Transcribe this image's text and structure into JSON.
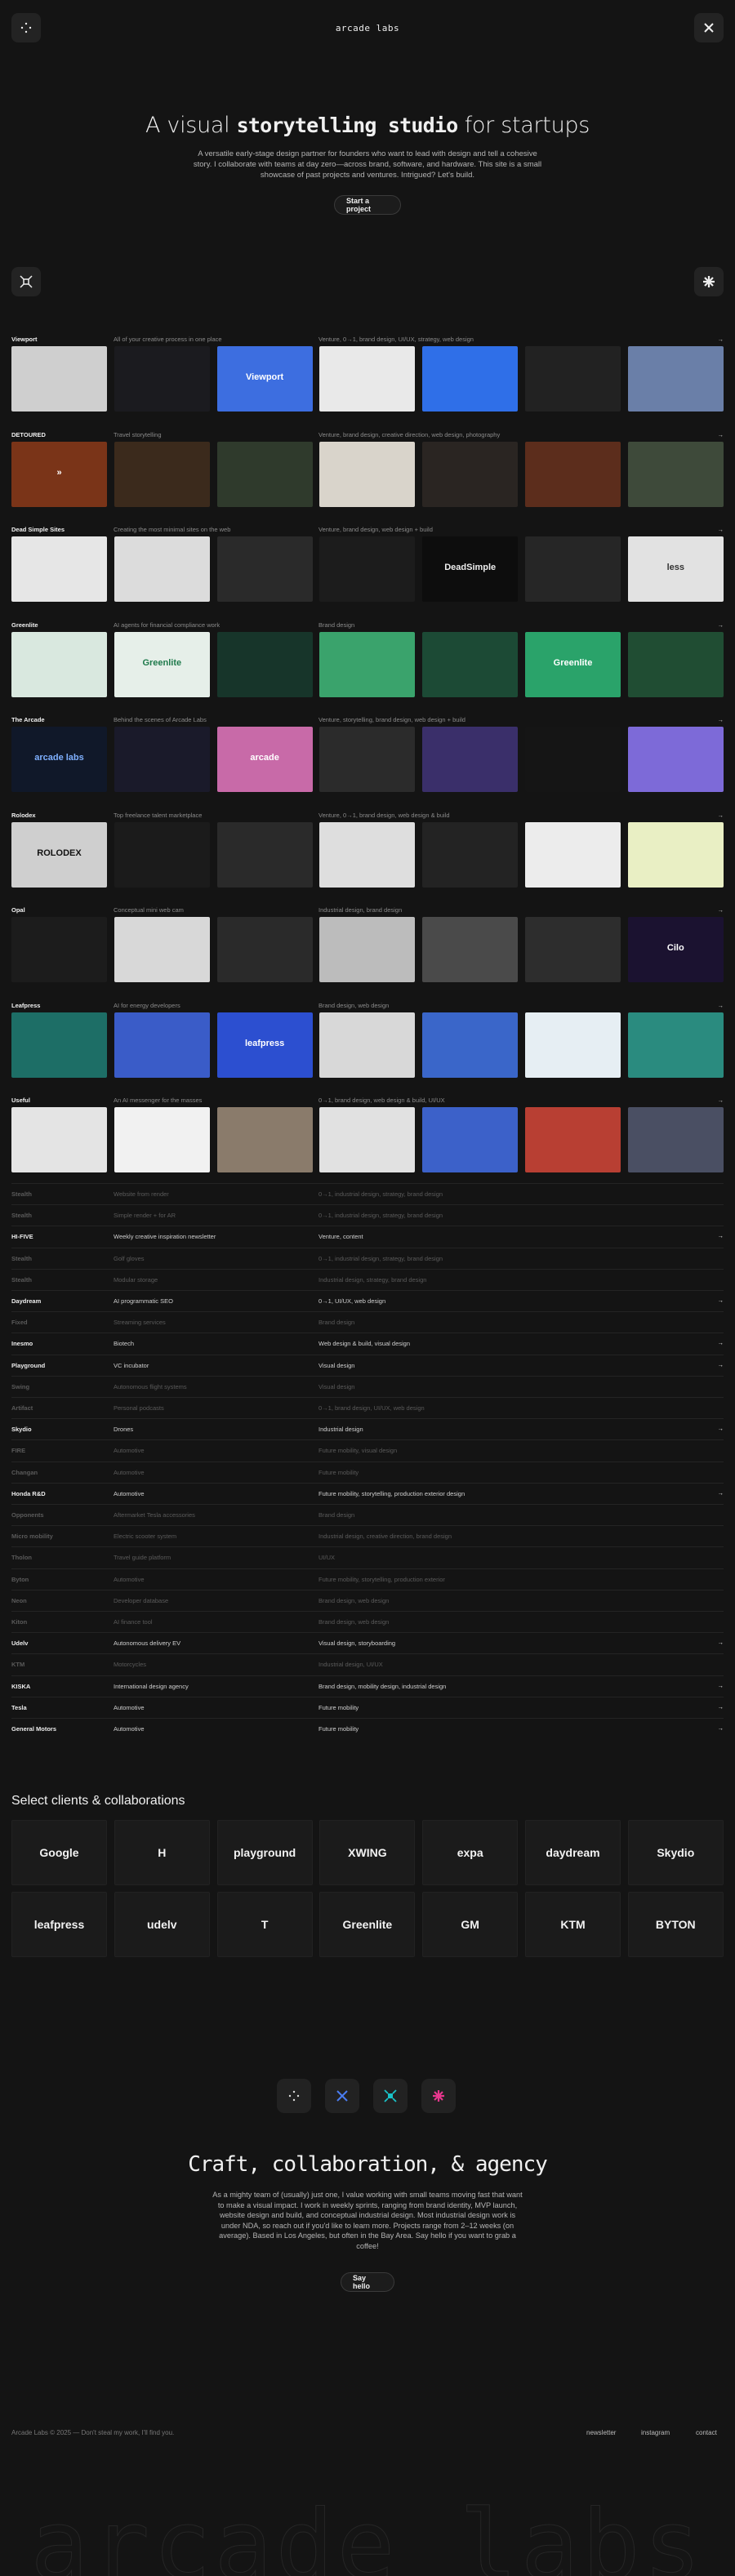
{
  "header": {
    "logo": "arcade labs"
  },
  "hero": {
    "title_pre": "A visual ",
    "title_bold": "storytelling studio",
    "title_post": " for startups",
    "subtitle": "A versatile early-stage design partner for founders who want to lead with design and tell a cohesive story. I collaborate with teams at day zero—across brand, software, and hardware. This site is a small showcase of past projects and ventures. Intrigued? Let's build.",
    "cta": "Start a project"
  },
  "projects": [
    {
      "name": "Viewport",
      "desc": "All of your creative process in one place",
      "tags": "Venture, 0→1, brand design, UI/UX, strategy, web design",
      "arrow": "→",
      "thumbs": [
        {
          "bg": "#cfcfcf",
          "fg": "#777",
          "label": ""
        },
        {
          "bg": "#1b1b1f",
          "fg": "#ddd",
          "label": ""
        },
        {
          "bg": "#3d6ee0",
          "fg": "#fff",
          "label": "Viewport"
        },
        {
          "bg": "#e9e9e9",
          "fg": "#888",
          "label": ""
        },
        {
          "bg": "#2f6fe8",
          "fg": "#fff",
          "label": ""
        },
        {
          "bg": "#222",
          "fg": "#eee",
          "label": ""
        },
        {
          "bg": "#6a7fa8",
          "fg": "#fff",
          "label": ""
        }
      ]
    },
    {
      "name": "DETOURED",
      "desc": "Travel storytelling",
      "tags": "Venture, brand design, creative direction, web design, photography",
      "arrow": "→",
      "thumbs": [
        {
          "bg": "#7a3418",
          "fg": "#fff",
          "label": "»"
        },
        {
          "bg": "#3b2a1c",
          "fg": "#eee",
          "label": ""
        },
        {
          "bg": "#2f3a2c",
          "fg": "#eee",
          "label": ""
        },
        {
          "bg": "#d9d4cb",
          "fg": "#333",
          "label": ""
        },
        {
          "bg": "#2a2522",
          "fg": "#eee",
          "label": ""
        },
        {
          "bg": "#5c2d1c",
          "fg": "#eee",
          "label": ""
        },
        {
          "bg": "#3e4a3a",
          "fg": "#eee",
          "label": ""
        }
      ]
    },
    {
      "name": "Dead Simple Sites",
      "desc": "Creating the most minimal sites on the web",
      "tags": "Venture, brand design, web design + build",
      "arrow": "→",
      "thumbs": [
        {
          "bg": "#e6e6e6",
          "fg": "#222",
          "label": ""
        },
        {
          "bg": "#dcdcdc",
          "fg": "#222",
          "label": ""
        },
        {
          "bg": "#2a2a2a",
          "fg": "#eee",
          "label": ""
        },
        {
          "bg": "#1c1c1c",
          "fg": "#eee",
          "label": ""
        },
        {
          "bg": "#0d0d0d",
          "fg": "#eee",
          "label": "DeadSimple"
        },
        {
          "bg": "#262626",
          "fg": "#eee",
          "label": ""
        },
        {
          "bg": "#e2e2e2",
          "fg": "#333",
          "label": "less"
        }
      ]
    },
    {
      "name": "Greenlite",
      "desc": "AI agents for financial compliance work",
      "tags": "Brand design",
      "arrow": "→",
      "thumbs": [
        {
          "bg": "#d9e8df",
          "fg": "#1f7a4c",
          "label": ""
        },
        {
          "bg": "#e6efe9",
          "fg": "#1f7a4c",
          "label": "Greenlite"
        },
        {
          "bg": "#17352a",
          "fg": "#eee",
          "label": ""
        },
        {
          "bg": "#3aa36c",
          "fg": "#fff",
          "label": ""
        },
        {
          "bg": "#1c4a35",
          "fg": "#eee",
          "label": ""
        },
        {
          "bg": "#2aa36a",
          "fg": "#fff",
          "label": "Greenlite"
        },
        {
          "bg": "#204d33",
          "fg": "#eee",
          "label": ""
        }
      ]
    },
    {
      "name": "The Arcade",
      "desc": "Behind the scenes of Arcade Labs",
      "tags": "Venture, storytelling, brand design, web design + build",
      "arrow": "→",
      "thumbs": [
        {
          "bg": "#101829",
          "fg": "#7fb0ff",
          "label": "arcade labs"
        },
        {
          "bg": "#1a1a2a",
          "fg": "#eee",
          "label": ""
        },
        {
          "bg": "#c86aa8",
          "fg": "#fff",
          "label": "arcade"
        },
        {
          "bg": "#2b2b2b",
          "fg": "#eee",
          "label": ""
        },
        {
          "bg": "#3a2f6a",
          "fg": "#fff",
          "label": ""
        },
        {
          "bg": "#151515",
          "fg": "#eee",
          "label": ""
        },
        {
          "bg": "#7d6ad8",
          "fg": "#fff",
          "label": ""
        }
      ]
    },
    {
      "name": "Rolodex",
      "desc": "Top freelance talent marketplace",
      "tags": "Venture, 0→1, brand design, web design & build",
      "arrow": "→",
      "thumbs": [
        {
          "bg": "#cfcfcf",
          "fg": "#111",
          "label": "ROLODEX"
        },
        {
          "bg": "#1b1b1b",
          "fg": "#eee",
          "label": ""
        },
        {
          "bg": "#2a2a2a",
          "fg": "#eee",
          "label": ""
        },
        {
          "bg": "#dedede",
          "fg": "#222",
          "label": ""
        },
        {
          "bg": "#232323",
          "fg": "#eee",
          "label": ""
        },
        {
          "bg": "#ececec",
          "fg": "#222",
          "label": ""
        },
        {
          "bg": "#e9efc4",
          "fg": "#222",
          "label": ""
        }
      ]
    },
    {
      "name": "Opal",
      "desc": "Conceptual mini web cam",
      "tags": "Industrial design, brand design",
      "arrow": "→",
      "thumbs": [
        {
          "bg": "#1c1c1c",
          "fg": "#eee",
          "label": ""
        },
        {
          "bg": "#d8d8d8",
          "fg": "#222",
          "label": ""
        },
        {
          "bg": "#2a2a2a",
          "fg": "#eee",
          "label": ""
        },
        {
          "bg": "#bcbcbc",
          "fg": "#222",
          "label": ""
        },
        {
          "bg": "#4a4a4a",
          "fg": "#eee",
          "label": ""
        },
        {
          "bg": "#2d2d2d",
          "fg": "#eee",
          "label": ""
        },
        {
          "bg": "#1b1230",
          "fg": "#fff",
          "label": "Cilo"
        }
      ]
    },
    {
      "name": "Leafpress",
      "desc": "AI for energy developers",
      "tags": "Brand design, web design",
      "arrow": "→",
      "thumbs": [
        {
          "bg": "#1d6e66",
          "fg": "#c8f25a",
          "label": ""
        },
        {
          "bg": "#3a5cc8",
          "fg": "#fff",
          "label": ""
        },
        {
          "bg": "#2c4fd0",
          "fg": "#fff",
          "label": "leafpress"
        },
        {
          "bg": "#d8d8d8",
          "fg": "#222",
          "label": ""
        },
        {
          "bg": "#3a66c9",
          "fg": "#fff",
          "label": ""
        },
        {
          "bg": "#e6eef3",
          "fg": "#2a6a6a",
          "label": ""
        },
        {
          "bg": "#2a8b7f",
          "fg": "#fff",
          "label": ""
        }
      ]
    },
    {
      "name": "Useful",
      "desc": "An AI messenger for the masses",
      "tags": "0→1, brand design, web design & build, UI/UX",
      "arrow": "→",
      "thumbs": [
        {
          "bg": "#e4e4e4",
          "fg": "#222",
          "label": ""
        },
        {
          "bg": "#f1f1f1",
          "fg": "#222",
          "label": ""
        },
        {
          "bg": "#8a7b6b",
          "fg": "#fff",
          "label": ""
        },
        {
          "bg": "#e1e1e1",
          "fg": "#222",
          "label": ""
        },
        {
          "bg": "#3c61c9",
          "fg": "#fff",
          "label": ""
        },
        {
          "bg": "#b83f33",
          "fg": "#fff",
          "label": ""
        },
        {
          "bg": "#4a4f63",
          "fg": "#fff",
          "label": ""
        }
      ]
    }
  ],
  "table_rows": [
    {
      "name": "Stealth",
      "desc": "Website from render",
      "tags": "0→1, industrial design, strategy, brand design",
      "arrow": "",
      "lit": false
    },
    {
      "name": "Stealth",
      "desc": "Simple render + for AR",
      "tags": "0→1, industrial design, strategy, brand design",
      "arrow": "",
      "lit": false
    },
    {
      "name": "HI-FIVE",
      "desc": "Weekly creative inspiration newsletter",
      "tags": "Venture, content",
      "arrow": "→",
      "lit": true
    },
    {
      "name": "Stealth",
      "desc": "Golf gloves",
      "tags": "0→1, industrial design, strategy, brand design",
      "arrow": "",
      "lit": false
    },
    {
      "name": "Stealth",
      "desc": "Modular storage",
      "tags": "Industrial design, strategy, brand design",
      "arrow": "",
      "lit": false
    },
    {
      "name": "Daydream",
      "desc": "AI programmatic SEO",
      "tags": "0→1, UI/UX, web design",
      "arrow": "→",
      "lit": true
    },
    {
      "name": "Fixed",
      "desc": "Streaming services",
      "tags": "Brand design",
      "arrow": "",
      "lit": false
    },
    {
      "name": "Inesmo",
      "desc": "Biotech",
      "tags": "Web design & build, visual design",
      "arrow": "→",
      "lit": true
    },
    {
      "name": "Playground",
      "desc": "VC incubator",
      "tags": "Visual design",
      "arrow": "→",
      "lit": true
    },
    {
      "name": "Swing",
      "desc": "Autonomous flight systems",
      "tags": "Visual design",
      "arrow": "",
      "lit": false
    },
    {
      "name": "Artifact",
      "desc": "Personal podcasts",
      "tags": "0→1, brand design, UI/UX, web design",
      "arrow": "",
      "lit": false
    },
    {
      "name": "Skydio",
      "desc": "Drones",
      "tags": "Industrial design",
      "arrow": "→",
      "lit": true
    },
    {
      "name": "FIRE",
      "desc": "Automotive",
      "tags": "Future mobility, visual design",
      "arrow": "",
      "lit": false
    },
    {
      "name": "Changan",
      "desc": "Automotive",
      "tags": "Future mobility",
      "arrow": "",
      "lit": false
    },
    {
      "name": "Honda R&D",
      "desc": "Automotive",
      "tags": "Future mobility, storytelling, production exterior design",
      "arrow": "→",
      "lit": true
    },
    {
      "name": "Opponents",
      "desc": "Aftermarket Tesla accessories",
      "tags": "Brand design",
      "arrow": "",
      "lit": false
    },
    {
      "name": "Micro mobility",
      "desc": "Electric scooter system",
      "tags": "Industrial design, creative direction, brand design",
      "arrow": "",
      "lit": false
    },
    {
      "name": "Tholon",
      "desc": "Travel guide platform",
      "tags": "UI/UX",
      "arrow": "",
      "lit": false
    },
    {
      "name": "Byton",
      "desc": "Automotive",
      "tags": "Future mobility, storytelling, production exterior",
      "arrow": "",
      "lit": false
    },
    {
      "name": "Neon",
      "desc": "Developer database",
      "tags": "Brand design, web design",
      "arrow": "",
      "lit": false
    },
    {
      "name": "Kiton",
      "desc": "AI finance tool",
      "tags": "Brand design, web design",
      "arrow": "",
      "lit": false
    },
    {
      "name": "Udelv",
      "desc": "Autonomous delivery EV",
      "tags": "Visual design, storyboarding",
      "arrow": "→",
      "lit": true
    },
    {
      "name": "KTM",
      "desc": "Motorcycles",
      "tags": "Industrial design, UI/UX",
      "arrow": "",
      "lit": false
    },
    {
      "name": "KISKA",
      "desc": "International design agency",
      "tags": "Brand design, mobility design, industrial design",
      "arrow": "→",
      "lit": true
    },
    {
      "name": "Tesla",
      "desc": "Automotive",
      "tags": "Future mobility",
      "arrow": "→",
      "lit": true
    },
    {
      "name": "General Motors",
      "desc": "Automotive",
      "tags": "Future mobility",
      "arrow": "→",
      "lit": true
    }
  ],
  "clients": {
    "title": "Select clients & collaborations",
    "logos": [
      "Google",
      "H",
      "playground",
      "XWING",
      "expa",
      "daydream",
      "Skydio",
      "leafpress",
      "udelv",
      "T",
      "Greenlite",
      "GM",
      "KTM",
      "BYTON"
    ]
  },
  "craft": {
    "title": "Craft, collaboration, & agency",
    "body": "As a mighty team of (usually) just one, I value working with small teams moving fast that want to make a visual impact. I work in weekly sprints, ranging from brand identity, MVP launch, website design and build, and conceptual industrial design. Most industrial design work is under NDA, so reach out if you'd like to learn more. Projects range from 2–12 weeks (on average). Based in Los Angeles, but often in the Bay Area. Say hello if you want to grab a coffee!",
    "cta": "Say hello"
  },
  "footer": {
    "copyright": "Arcade Labs © 2025 — Don't steal my work, I'll find you.",
    "links": [
      "newsletter",
      "instagram",
      "contact"
    ],
    "big_logo": "arcade labs"
  },
  "colors": {
    "bg": "#141414",
    "accent_teal": "#19c2c8",
    "accent_pink": "#e8378e",
    "accent_blue": "#3d6ee0"
  }
}
